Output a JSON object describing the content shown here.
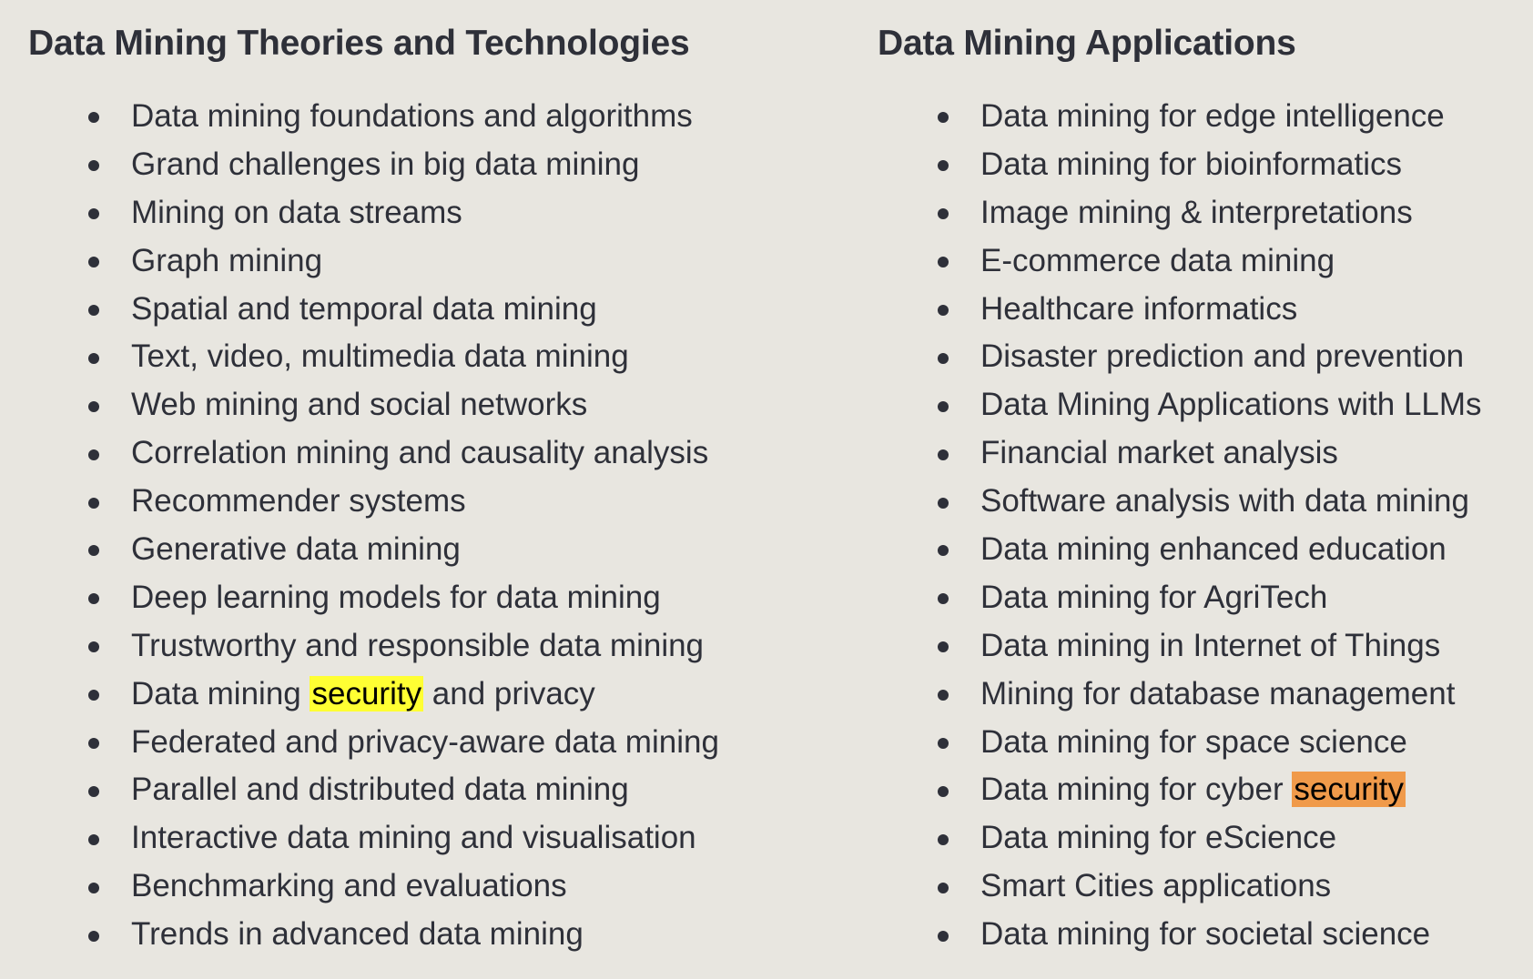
{
  "columns": [
    {
      "heading": "Data Mining Theories and Technologies",
      "items": [
        "Data mining foundations and algorithms",
        "Grand challenges in big data mining",
        "Mining on data streams",
        "Graph mining",
        "Spatial and temporal data mining",
        "Text, video, multimedia data mining",
        "Web mining and social networks",
        "Correlation mining and causality analysis",
        "Recommender systems",
        "Generative data mining",
        "Deep learning models for data mining",
        "Trustworthy and responsible data mining",
        {
          "before": "Data mining ",
          "highlight": "security",
          "after": " and privacy",
          "highlight_color": "#ffff33"
        },
        "Federated and privacy-aware data mining",
        "Parallel and distributed data mining",
        "Interactive data mining and visualisation",
        "Benchmarking and evaluations",
        "Trends in advanced data mining"
      ]
    },
    {
      "heading": "Data Mining Applications",
      "items": [
        "Data mining for edge intelligence",
        "Data mining for bioinformatics",
        "Image mining & interpretations",
        "E-commerce data mining",
        "Healthcare informatics",
        "Disaster prediction and prevention",
        "Data Mining Applications with LLMs",
        "Financial market analysis",
        "Software analysis with data mining",
        "Data mining enhanced education",
        "Data mining for AgriTech",
        "Data mining in Internet of Things",
        "Mining for database management",
        "Data mining for space science",
        {
          "before": "Data mining for cyber ",
          "highlight": "security",
          "after": "",
          "highlight_color": "#f09a4a"
        },
        "Data mining for eScience",
        "Smart Cities applications",
        "Data mining for societal science"
      ]
    }
  ],
  "colors": {
    "background": "#e8e6e0",
    "text": "#2e3039",
    "highlight_yellow": "#ffff33",
    "highlight_orange": "#f09a4a"
  }
}
